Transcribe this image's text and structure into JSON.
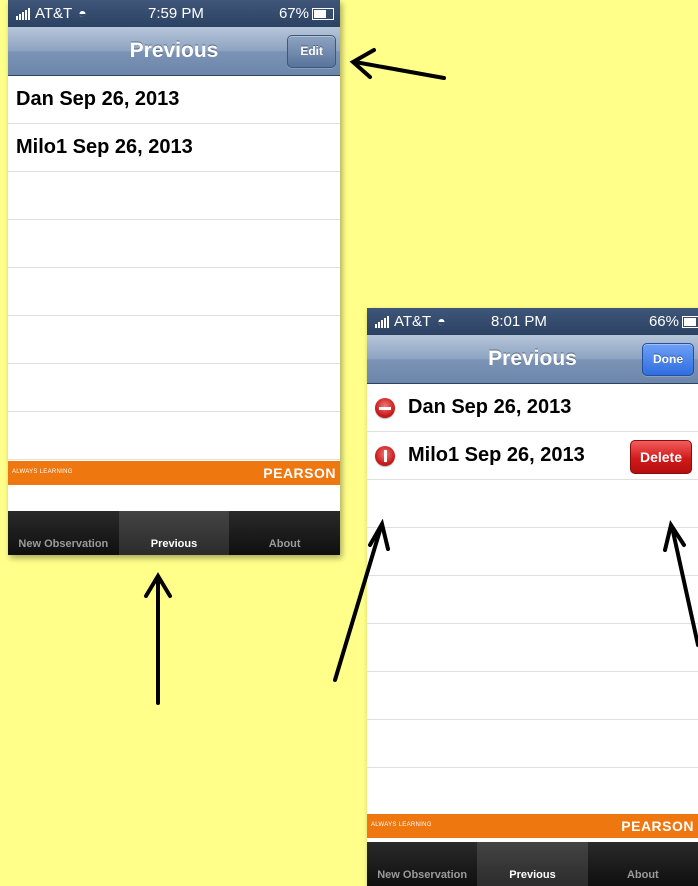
{
  "phone_left": {
    "status": {
      "carrier": "AT&T",
      "time": "7:59 PM",
      "battery": "67%"
    },
    "navbar": {
      "title": "Previous",
      "button": "Edit"
    },
    "rows": [
      "Dan Sep 26, 2013",
      "Milo1 Sep 26, 2013",
      "",
      "",
      "",
      "",
      "",
      ""
    ],
    "footer": {
      "tagline": "ALWAYS LEARNING",
      "brand": "PEARSON"
    },
    "tabs": [
      "New Observation",
      "Previous",
      "About"
    ]
  },
  "phone_right": {
    "status": {
      "carrier": "AT&T",
      "time": "8:01 PM",
      "battery": "66%"
    },
    "navbar": {
      "title": "Previous",
      "button": "Done"
    },
    "rows": [
      "Dan Sep 26, 2013",
      "Milo1 Sep 26, 2013",
      "",
      "",
      "",
      "",
      "",
      ""
    ],
    "delete_label": "Delete",
    "footer": {
      "tagline": "ALWAYS LEARNING",
      "brand": "PEARSON"
    },
    "tabs": [
      "New Observation",
      "Previous",
      "About"
    ]
  },
  "colors": {
    "background": "#FFFF8A",
    "navbar": "#8ca3c2",
    "done_button": "#2f6ee0",
    "delete_button": "#d11a1a",
    "pearson_orange": "#ef7710"
  },
  "icons": {
    "signal": "signal-bars-icon",
    "wifi": "wifi-icon",
    "battery": "battery-icon",
    "delete_control": "minus-circle-icon",
    "delete_control_rotated": "rotated-minus-circle-icon",
    "annotation": "arrow-icon"
  }
}
